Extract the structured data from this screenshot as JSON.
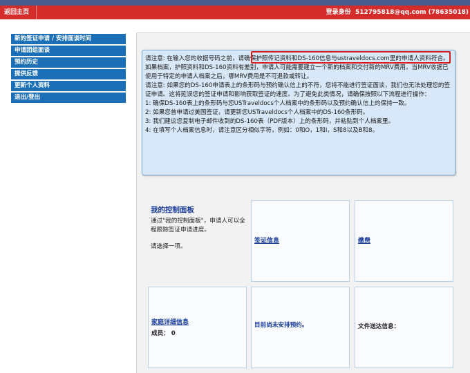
{
  "header": {
    "home": "返回主页",
    "login_label": "登录身份",
    "login_value": "512795818@qq.com (78635018)"
  },
  "nav": [
    "新的签证申请 / 安排面谈时间",
    "申请团组面谈",
    "预约历史",
    "提供反馈",
    "更新个人资料",
    "退出/登出"
  ],
  "notice": {
    "p1_before": "请注意: 在输入您的收据号码之前，",
    "p1_highlight": "请确保护照传记资料和DS-160信息与ustraveldocs.com",
    "p1_after": "里的申请人资料符合。如果档案，护照资料和DS-160资料有差别，申请人可能需要建立一个新的档案和交付新的MRV费用。当MRV收据已使用于特定的申请人档案之后，哪MRV费用是不可退款或转让。",
    "p2": "请注意: 如果您的DS-160申请表上的条形码与预约确认信上的不符，您将不能进行签证面谈，我们也无法处理您的签证申请。这将延误您的签证申请和影响获取签证的速度。为了避免此类情况，请确保按照以下流程进行操作：",
    "steps": [
      "1: 确保DS-160表上的条形码与您USTraveldocs个人档案中的条形码以及预约确认信上的保持一致。",
      "2: 如果您曾申请过美国签证，请更新您USTraveldocs个人档案中的DS-160条形码。",
      "3: 我们建议您复制电子邮件收到的DS-160表（PDF版本）上的条形码，并粘贴到个人档案里。",
      "4: 在填写个人档案信息时，请注意区分相似字符，例如：0和O，1和I，S和8以及B和8。"
    ]
  },
  "dashboard": {
    "title": "我的控制面板",
    "desc": "通过\"我的控制面板\"，申请人可以全程跟踪签证申请进度。",
    "select": "请选择一项。",
    "visa_info": "签证信息",
    "payment": "缴费",
    "family": "家庭详细信息",
    "members_label": "成员：",
    "members_count": "0",
    "no_appointment": "目前尚未安排预约。",
    "delivery": "文件送达信息："
  }
}
